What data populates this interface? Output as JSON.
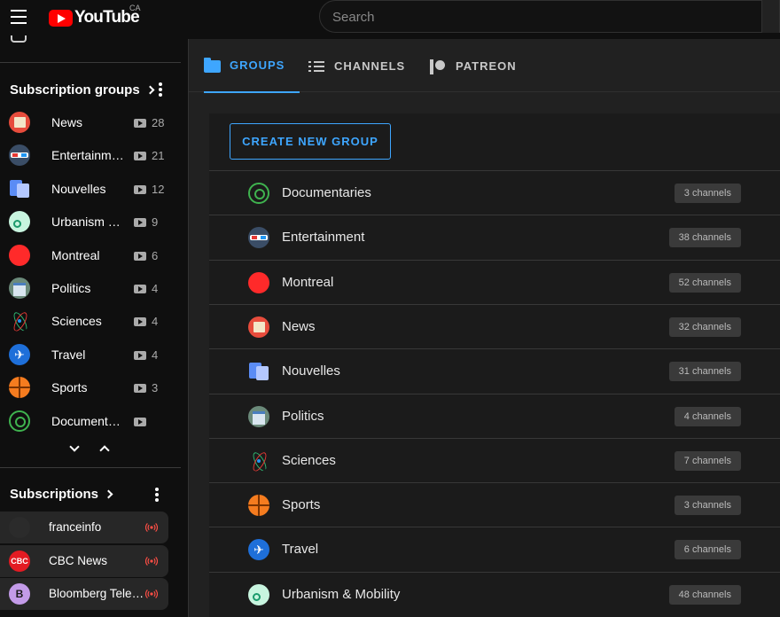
{
  "header": {
    "logo_text": "YouTube",
    "country": "CA",
    "search_placeholder": "Search"
  },
  "sidebar": {
    "groups_title": "Subscription groups",
    "groups": [
      {
        "label": "News",
        "count": "28",
        "icon": "newspaper-icon"
      },
      {
        "label": "Entertainment",
        "count": "21",
        "icon": "3d-glasses-icon"
      },
      {
        "label": "Nouvelles",
        "count": "12",
        "icon": "newspaper-blue-icon"
      },
      {
        "label": "Urbanism & Mobility",
        "count": "9",
        "icon": "bicycle-icon"
      },
      {
        "label": "Montreal",
        "count": "6",
        "icon": "red-circle-icon"
      },
      {
        "label": "Politics",
        "count": "4",
        "icon": "politics-icon"
      },
      {
        "label": "Sciences",
        "count": "4",
        "icon": "atom-icon"
      },
      {
        "label": "Travel",
        "count": "4",
        "icon": "airplane-icon"
      },
      {
        "label": "Sports",
        "count": "3",
        "icon": "basketball-icon"
      },
      {
        "label": "Documentaries",
        "count": "",
        "icon": "brain-icon"
      }
    ],
    "subscriptions_title": "Subscriptions",
    "subscriptions": [
      {
        "label": "franceinfo",
        "avatar_text": "",
        "avatar_color": "#2b2b2b"
      },
      {
        "label": "CBC News",
        "avatar_text": "CBC",
        "avatar_color": "#e31b23"
      },
      {
        "label": "Bloomberg Television",
        "avatar_text": "B",
        "avatar_color": "#c39be8"
      }
    ]
  },
  "tabs": [
    {
      "label": "GROUPS",
      "active": true
    },
    {
      "label": "CHANNELS",
      "active": false
    },
    {
      "label": "PATREON",
      "active": false
    }
  ],
  "main": {
    "create_button": "CREATE NEW GROUP",
    "groups": [
      {
        "label": "Documentaries",
        "channels": "3 channels"
      },
      {
        "label": "Entertainment",
        "channels": "38 channels"
      },
      {
        "label": "Montreal",
        "channels": "52 channels"
      },
      {
        "label": "News",
        "channels": "32 channels"
      },
      {
        "label": "Nouvelles",
        "channels": "31 channels"
      },
      {
        "label": "Politics",
        "channels": "4 channels"
      },
      {
        "label": "Sciences",
        "channels": "7 channels"
      },
      {
        "label": "Sports",
        "channels": "3 channels"
      },
      {
        "label": "Travel",
        "channels": "6 channels"
      },
      {
        "label": "Urbanism & Mobility",
        "channels": "48 channels"
      }
    ]
  },
  "colors": {
    "accent": "#3ea6ff",
    "brand_red": "#ff0000",
    "live": "#ff4e45"
  }
}
